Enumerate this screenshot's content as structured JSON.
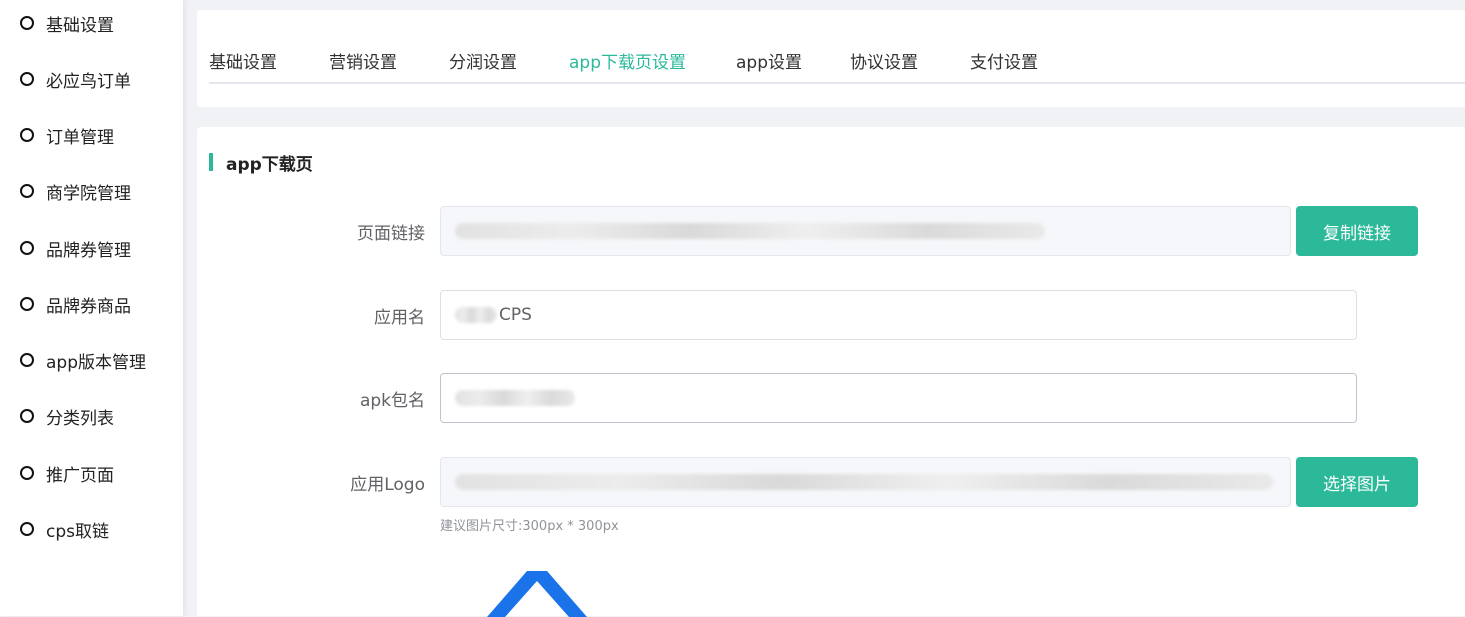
{
  "sidebar": {
    "items": [
      {
        "label": "基础设置"
      },
      {
        "label": "必应鸟订单"
      },
      {
        "label": "订单管理"
      },
      {
        "label": "商学院管理"
      },
      {
        "label": "品牌券管理"
      },
      {
        "label": "品牌券商品"
      },
      {
        "label": "app版本管理"
      },
      {
        "label": "分类列表"
      },
      {
        "label": "推广页面"
      },
      {
        "label": "cps取链"
      }
    ]
  },
  "tabs": [
    {
      "label": "基础设置"
    },
    {
      "label": "营销设置"
    },
    {
      "label": "分润设置"
    },
    {
      "label": "app下载页设置",
      "active": true
    },
    {
      "label": "app设置"
    },
    {
      "label": "协议设置"
    },
    {
      "label": "支付设置"
    }
  ],
  "section": {
    "title": "app下载页"
  },
  "form": {
    "page_link": {
      "label": "页面链接",
      "value": "",
      "button": "复制链接"
    },
    "app_name": {
      "label": "应用名",
      "value": "CPS"
    },
    "apk_package": {
      "label": "apk包名",
      "value": ""
    },
    "app_logo": {
      "label": "应用Logo",
      "value": "",
      "button": "选择图片",
      "hint": "建议图片尺寸:300px * 300px"
    }
  },
  "colors": {
    "accent": "#2bb99a",
    "logo_blue": "#1a73e8"
  }
}
